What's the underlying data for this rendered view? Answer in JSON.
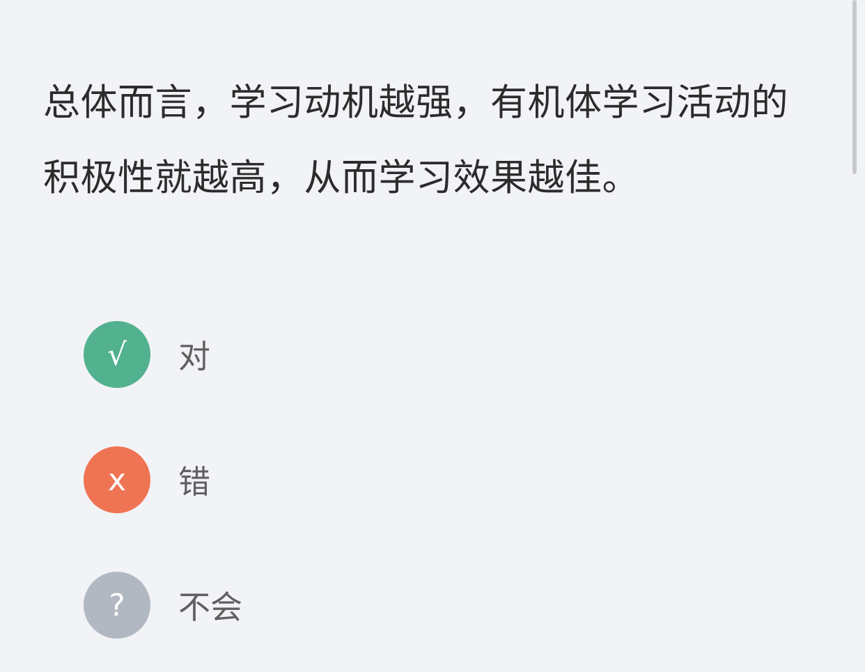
{
  "question": {
    "text": "总体而言，学习动机越强，有机体学习活动的积极性就越高，从而学习效果越佳。"
  },
  "options": [
    {
      "symbol": "√",
      "label": "对",
      "color": "#52b18e",
      "icon": "checkmark-icon"
    },
    {
      "symbol": "x",
      "label": "错",
      "color": "#ef7454",
      "icon": "cross-icon"
    },
    {
      "symbol": "?",
      "label": "不会",
      "color": "#b2b8c2",
      "icon": "question-icon"
    }
  ]
}
